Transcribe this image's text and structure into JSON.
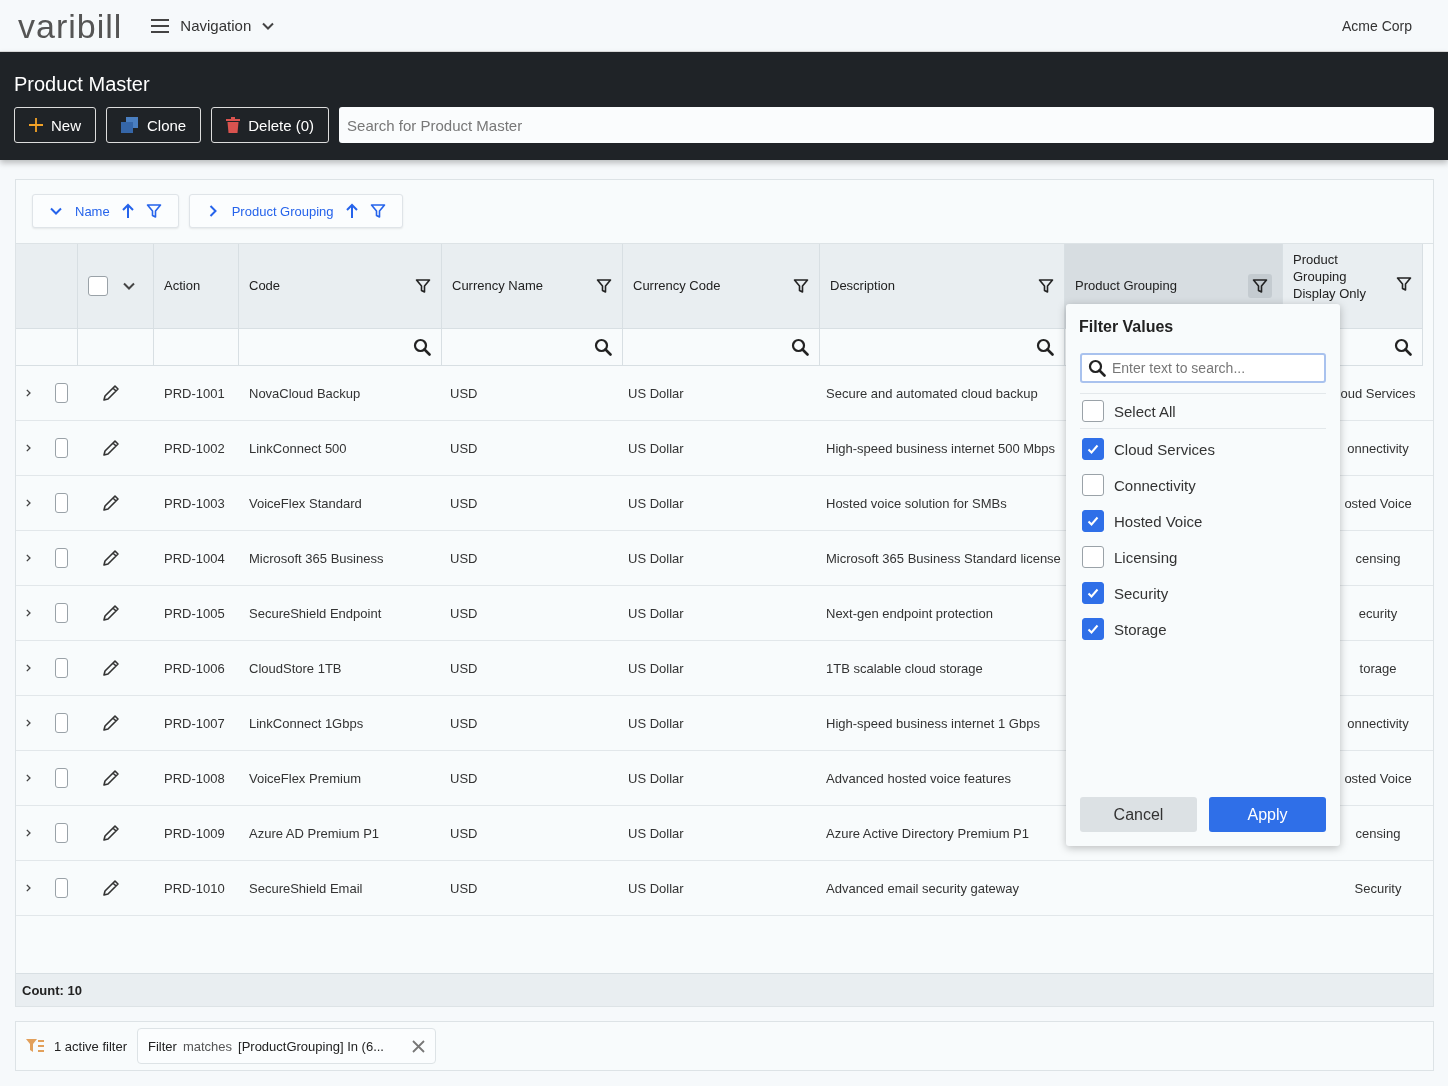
{
  "header": {
    "logo": "varibill",
    "navigation": "Navigation",
    "account": "Acme Corp"
  },
  "page": {
    "title": "Product Master",
    "buttons": [
      {
        "kind": "new",
        "label": "New"
      },
      {
        "kind": "clone",
        "label": "Clone"
      },
      {
        "kind": "delete",
        "label": "Delete (0)"
      }
    ],
    "search": {
      "placeholder": "Search for Product Master"
    }
  },
  "grouping": [
    {
      "label": "Name",
      "expanded": true
    },
    {
      "label": "Product Grouping",
      "expanded": false
    }
  ],
  "table": {
    "select_all_checked": false,
    "columns": [
      {
        "label": "Action",
        "kind": "plain",
        "selected": false
      },
      {
        "label": "Code",
        "kind": "filter",
        "selected": false
      },
      {
        "label": "Currency Name",
        "kind": "filter",
        "selected": false
      },
      {
        "label": "Currency Code",
        "kind": "filter",
        "selected": false
      },
      {
        "label": "Description",
        "kind": "filter",
        "selected": false
      },
      {
        "label": "Product Grouping",
        "kind": "filter",
        "selected": true
      },
      {
        "label": "Product Grouping Display Only",
        "kind": "filter",
        "selected": false
      }
    ],
    "rows": [
      {
        "checked": false,
        "code": "PRD-1001",
        "name": "NovaCloud Backup",
        "currency": "USD",
        "currency_name": "US Dollar",
        "description": "Secure and automated cloud backup",
        "grouping": "oud Services"
      },
      {
        "checked": false,
        "code": "PRD-1002",
        "name": "LinkConnect 500",
        "currency": "USD",
        "currency_name": "US Dollar",
        "description": "High-speed business internet 500 Mbps",
        "grouping": "onnectivity"
      },
      {
        "checked": false,
        "code": "PRD-1003",
        "name": "VoiceFlex Standard",
        "currency": "USD",
        "currency_name": "US Dollar",
        "description": "Hosted voice solution for SMBs",
        "grouping": "osted Voice"
      },
      {
        "checked": false,
        "code": "PRD-1004",
        "name": "Microsoft 365 Business",
        "currency": "USD",
        "currency_name": "US Dollar",
        "description": "Microsoft 365 Business Standard license",
        "grouping": "censing"
      },
      {
        "checked": false,
        "code": "PRD-1005",
        "name": "SecureShield Endpoint",
        "currency": "USD",
        "currency_name": "US Dollar",
        "description": "Next-gen endpoint protection",
        "grouping": "ecurity"
      },
      {
        "checked": false,
        "code": "PRD-1006",
        "name": "CloudStore 1TB",
        "currency": "USD",
        "currency_name": "US Dollar",
        "description": "1TB scalable cloud storage",
        "grouping": "torage"
      },
      {
        "checked": false,
        "code": "PRD-1007",
        "name": "LinkConnect 1Gbps",
        "currency": "USD",
        "currency_name": "US Dollar",
        "description": "High-speed business internet 1 Gbps",
        "grouping": "onnectivity"
      },
      {
        "checked": false,
        "code": "PRD-1008",
        "name": "VoiceFlex Premium",
        "currency": "USD",
        "currency_name": "US Dollar",
        "description": "Advanced hosted voice features",
        "grouping": "osted Voice"
      },
      {
        "checked": false,
        "code": "PRD-1009",
        "name": "Azure AD Premium P1",
        "currency": "USD",
        "currency_name": "US Dollar",
        "description": "Azure Active Directory Premium P1",
        "grouping": "censing"
      },
      {
        "checked": false,
        "code": "PRD-1010",
        "name": "SecureShield Email",
        "currency": "USD",
        "currency_name": "US Dollar",
        "description": "Advanced email security gateway",
        "grouping": "Security"
      }
    ],
    "count": "Count: 10"
  },
  "filter_popup": {
    "title": "Filter Values",
    "search": {
      "placeholder": "Enter text to search..."
    },
    "select_all": {
      "label": "Select All",
      "checked": false
    },
    "values": [
      {
        "label": "Cloud Services",
        "checked": true
      },
      {
        "label": "Connectivity",
        "checked": false
      },
      {
        "label": "Hosted Voice",
        "checked": true
      },
      {
        "label": "Licensing",
        "checked": false
      },
      {
        "label": "Security",
        "checked": true
      },
      {
        "label": "Storage",
        "checked": true
      }
    ],
    "buttons": {
      "cancel": "Cancel",
      "apply": "Apply"
    }
  },
  "active_filters": {
    "summary": "1 active filter",
    "chip": {
      "label": "Filter",
      "operator": "matches",
      "expression": "[ProductGrouping] In (6..."
    }
  }
}
